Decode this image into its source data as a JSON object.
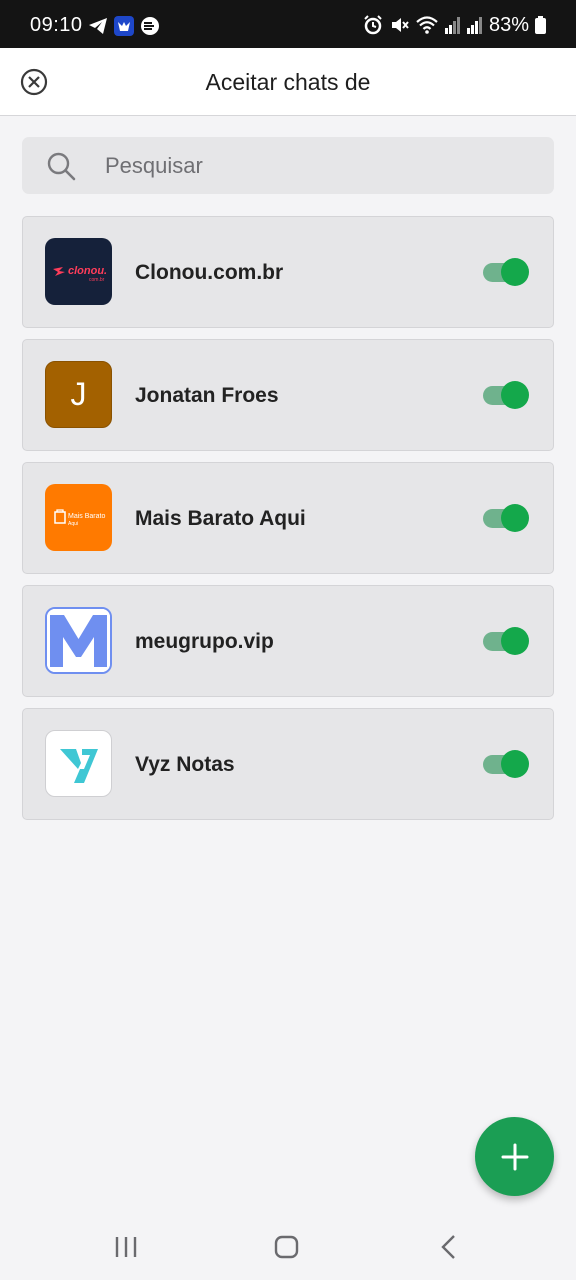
{
  "status_bar": {
    "time": "09:10",
    "battery": "83%",
    "left_icons": [
      "telegram-icon",
      "app-shield-icon",
      "data-saver-icon"
    ],
    "right_icons": [
      "alarm-icon",
      "mute-icon",
      "wifi-icon",
      "signal-icon",
      "signal-icon",
      "battery-icon"
    ]
  },
  "header": {
    "title": "Aceitar chats de",
    "close_icon": "close-circle-icon"
  },
  "search": {
    "placeholder": "Pesquisar",
    "value": ""
  },
  "items": [
    {
      "label": "Clonou.com.br",
      "enabled": true,
      "avatar_bg": "#15213a"
    },
    {
      "label": "Jonatan Froes",
      "enabled": true,
      "avatar_bg": "#a36100",
      "avatar_letter": "J"
    },
    {
      "label": "Mais Barato Aqui",
      "enabled": true,
      "avatar_bg": "#ff7a00"
    },
    {
      "label": "meugrupo.vip",
      "enabled": true,
      "avatar_bg": "#ffffff"
    },
    {
      "label": "Vyz Notas",
      "enabled": true,
      "avatar_bg": "#ffffff"
    }
  ],
  "logo_text": {
    "clonou": "clonou.",
    "clonou_sub": "com.br",
    "mais_barato": "Mais Barato",
    "mais_barato_sub": "Aqui"
  },
  "fab": {
    "icon": "plus-icon"
  },
  "nav": [
    "recents-icon",
    "home-icon",
    "back-icon"
  ],
  "colors": {
    "accent": "#1b9e54",
    "toggle_on": "#14a84b",
    "toggle_track": "#6fb28d"
  }
}
